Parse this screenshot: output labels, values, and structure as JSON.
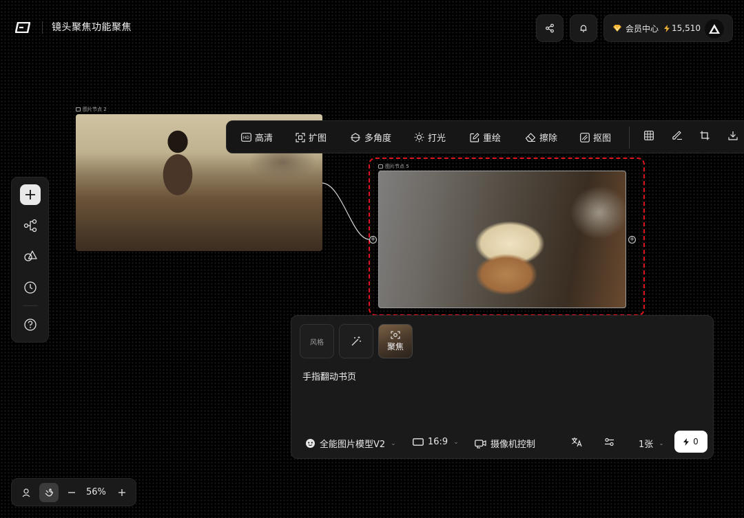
{
  "header": {
    "title": "镜头聚焦功能聚焦",
    "member_label": "会员中心",
    "credits": "15,510"
  },
  "left_toolbar": {
    "items": [
      "add",
      "workflow",
      "shapes",
      "history",
      "help"
    ]
  },
  "zoom": {
    "value": "56%"
  },
  "nodes": [
    {
      "label": "图片节点 2"
    },
    {
      "label": "图片节点 5"
    }
  ],
  "image_toolbar": {
    "tools": [
      {
        "label": "高清",
        "icon": "hd-icon"
      },
      {
        "label": "扩图",
        "icon": "expand-icon"
      },
      {
        "label": "多角度",
        "icon": "multi-angle-icon"
      },
      {
        "label": "打光",
        "icon": "light-icon"
      },
      {
        "label": "重绘",
        "icon": "redraw-icon"
      },
      {
        "label": "擦除",
        "icon": "eraser-icon"
      },
      {
        "label": "抠图",
        "icon": "cutout-icon"
      }
    ]
  },
  "prompt_panel": {
    "chips": {
      "style": "风格",
      "focus": "聚焦"
    },
    "prompt": "手指翻动书页",
    "model": "全能图片模型V2",
    "ratio": "16:9",
    "camera": "摄像机控制",
    "count": "1张",
    "cost": "0"
  },
  "colors": {
    "selection": "#e0141c",
    "gem": "#f2b233",
    "background": "#000000"
  }
}
